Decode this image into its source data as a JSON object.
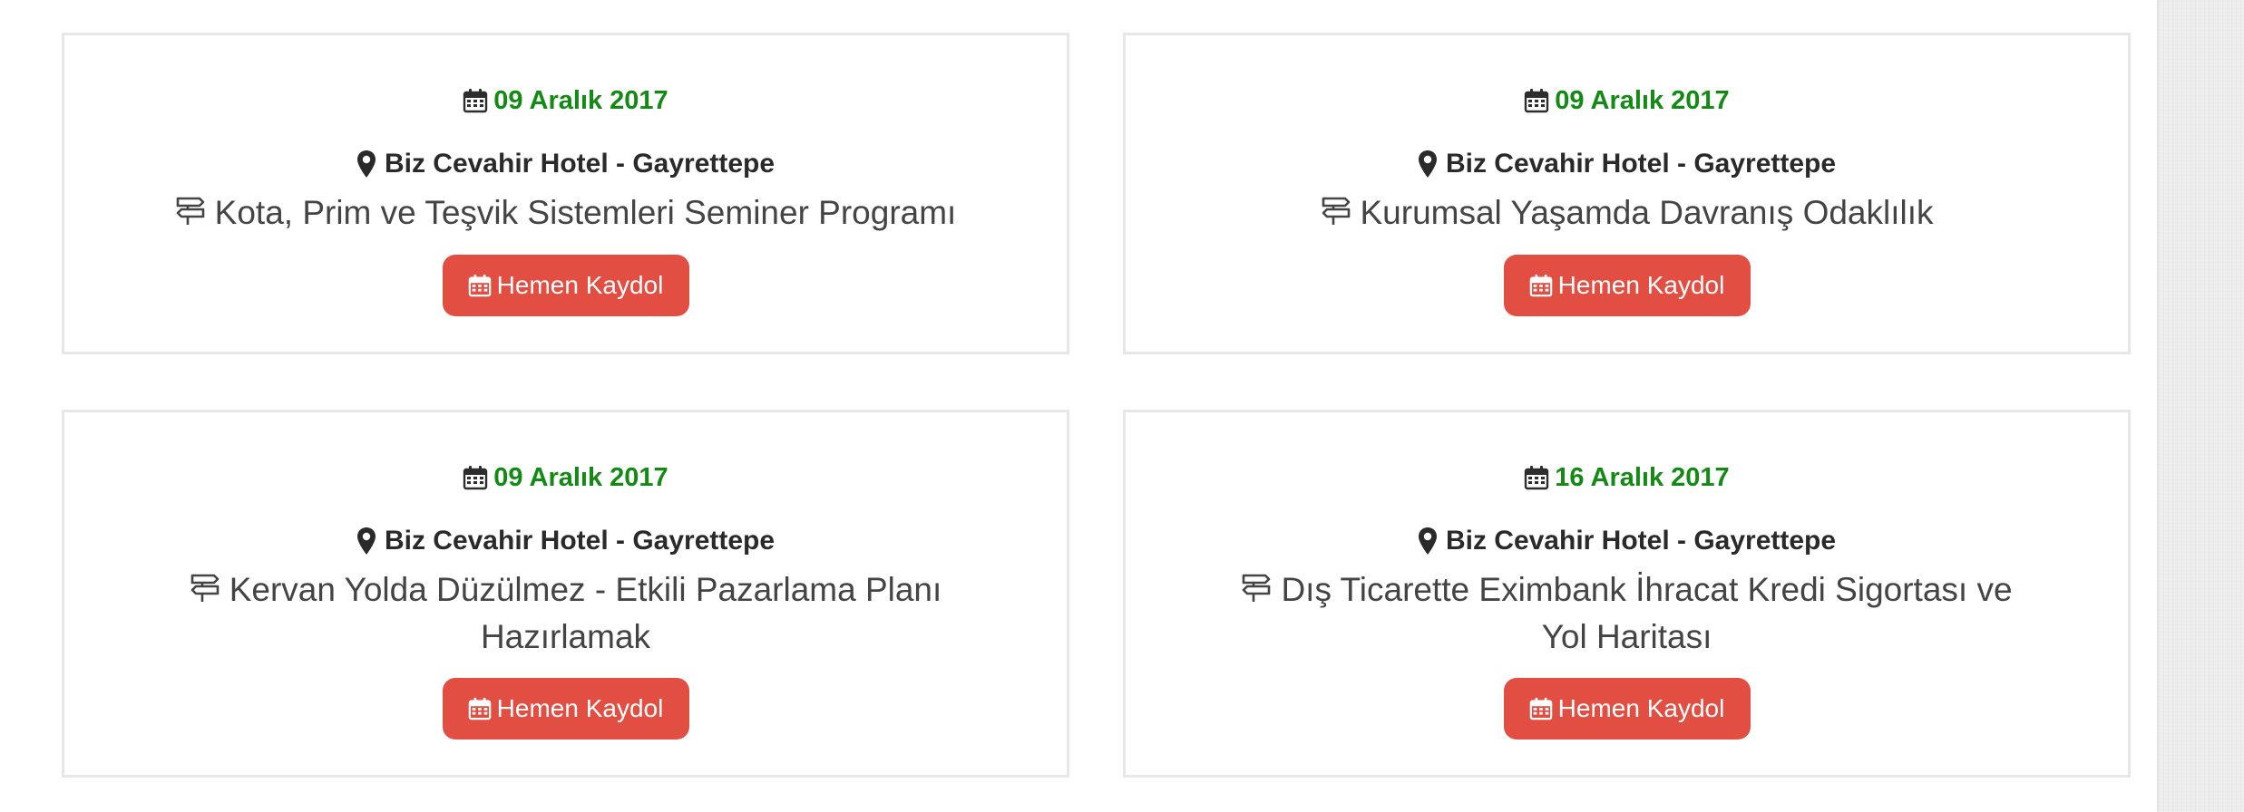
{
  "events": [
    {
      "date": "09 Aralık 2017",
      "venue": "Biz Cevahir Hotel - Gayrettepe",
      "title": "Kota, Prim ve Teşvik Sistemleri Seminer Programı",
      "button_label": "Hemen Kaydol",
      "date_icon": "calendar-icon",
      "venue_icon": "map-marker-icon",
      "title_icon": "signpost-icon"
    },
    {
      "date": "09 Aralık 2017",
      "venue": "Biz Cevahir Hotel - Gayrettepe",
      "title": "Kurumsal Yaşamda Davranış Odaklılık",
      "button_label": "Hemen Kaydol",
      "date_icon": "calendar-icon",
      "venue_icon": "map-marker-icon",
      "title_icon": "signpost-icon"
    },
    {
      "date": "09 Aralık 2017",
      "venue": "Biz Cevahir Hotel - Gayrettepe",
      "title": "Kervan Yolda Düzülmez - Etkili Pazarlama Planı Hazırlamak",
      "button_label": "Hemen Kaydol",
      "date_icon": "calendar-icon",
      "venue_icon": "map-marker-icon",
      "title_icon": "signpost-icon"
    },
    {
      "date": "16 Aralık 2017",
      "venue": "Biz Cevahir Hotel - Gayrettepe",
      "title": "Dış Ticarette Eximbank İhracat Kredi Sigortası ve Yol Haritası",
      "button_label": "Hemen Kaydol",
      "date_icon": "calendar-icon",
      "venue_icon": "map-marker-icon",
      "title_icon": "signpost-icon"
    }
  ],
  "colors": {
    "date_text": "#138a13",
    "button_bg": "#e24e42",
    "button_text": "#ffffff",
    "venue_text": "#2a2a2a",
    "title_text": "#444444",
    "card_border": "#e7e7e7"
  }
}
